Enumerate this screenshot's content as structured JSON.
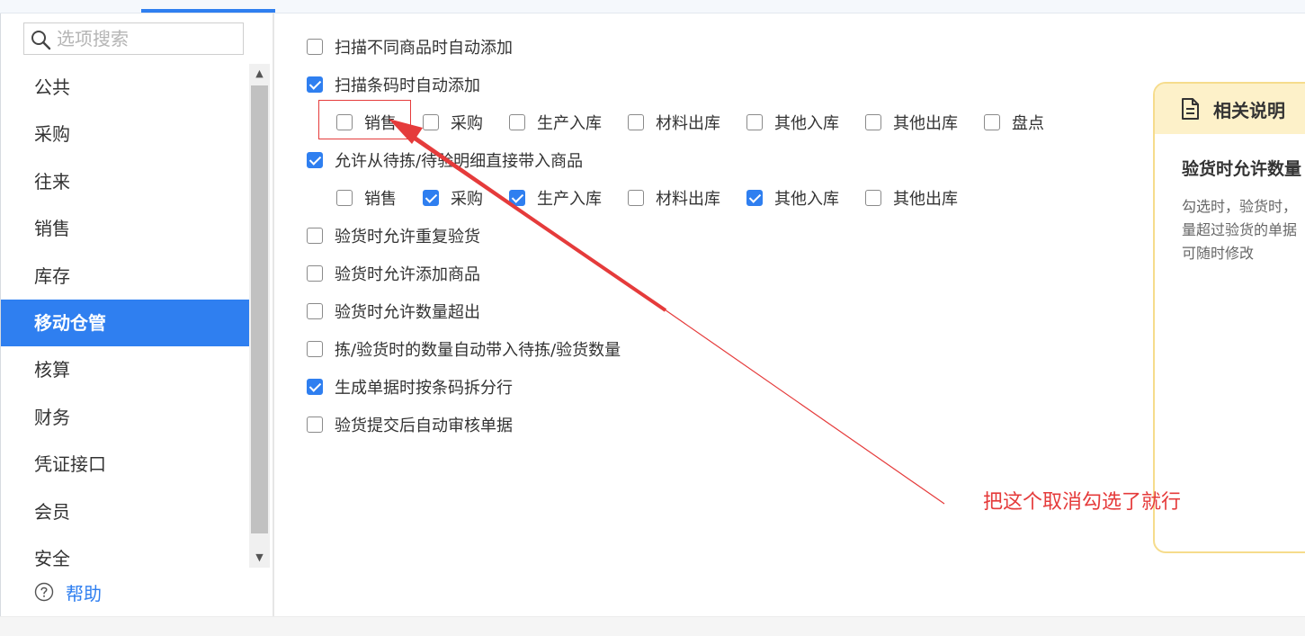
{
  "search": {
    "placeholder": "选项搜索"
  },
  "sidebar": {
    "items": [
      {
        "label": "公共"
      },
      {
        "label": "采购"
      },
      {
        "label": "往来"
      },
      {
        "label": "销售"
      },
      {
        "label": "库存"
      },
      {
        "label": "移动仓管",
        "active": true
      },
      {
        "label": "核算"
      },
      {
        "label": "财务"
      },
      {
        "label": "凭证接口"
      },
      {
        "label": "会员"
      },
      {
        "label": "安全"
      }
    ],
    "help_label": "帮助"
  },
  "options": {
    "scan_diff_add": {
      "label": "扫描不同商品时自动添加",
      "checked": false
    },
    "scan_barcode_add": {
      "label": "扫描条码时自动添加",
      "checked": true
    },
    "scan_barcode_sub": [
      {
        "label": "销售",
        "checked": false
      },
      {
        "label": "采购",
        "checked": false
      },
      {
        "label": "生产入库",
        "checked": false
      },
      {
        "label": "材料出库",
        "checked": false
      },
      {
        "label": "其他入库",
        "checked": false
      },
      {
        "label": "其他出库",
        "checked": false
      },
      {
        "label": "盘点",
        "checked": false
      }
    ],
    "allow_bring": {
      "label": "允许从待拣/待验明细直接带入商品",
      "checked": true
    },
    "allow_bring_sub": [
      {
        "label": "销售",
        "checked": false
      },
      {
        "label": "采购",
        "checked": true
      },
      {
        "label": "生产入库",
        "checked": true
      },
      {
        "label": "材料出库",
        "checked": false
      },
      {
        "label": "其他入库",
        "checked": true
      },
      {
        "label": "其他出库",
        "checked": false
      }
    ],
    "repeat_check": {
      "label": "验货时允许重复验货",
      "checked": false
    },
    "add_goods": {
      "label": "验货时允许添加商品",
      "checked": false
    },
    "qty_exceed": {
      "label": "验货时允许数量超出",
      "checked": false
    },
    "auto_qty": {
      "label": "拣/验货时的数量自动带入待拣/验货数量",
      "checked": false
    },
    "split_lines": {
      "label": "生成单据时按条码拆分行",
      "checked": true
    },
    "auto_audit": {
      "label": "验货提交后自动审核单据",
      "checked": false
    }
  },
  "help_panel": {
    "header": "相关说明",
    "title": "验货时允许数量",
    "body_lines": [
      "勾选时，验货时，",
      "量超过验货的单据",
      "可随时修改"
    ]
  },
  "annotation": {
    "text": "把这个取消勾选了就行"
  },
  "colors": {
    "accent": "#2f7ff0",
    "annotation": "#e53b3b",
    "help_border": "#f6dc8c",
    "help_header_bg": "#fdf1c9"
  }
}
